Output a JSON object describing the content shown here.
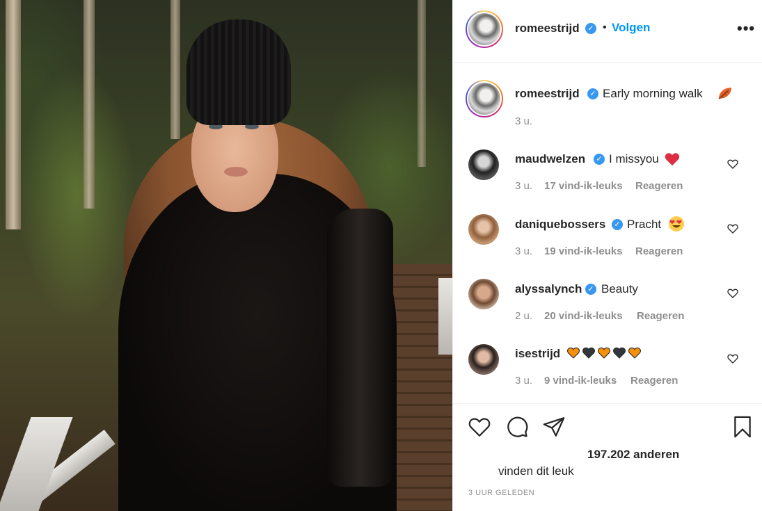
{
  "post": {
    "author": "romeestrijd",
    "follow_label": "Volgen",
    "follow_separator": "•",
    "more_label": "•••",
    "caption_author": "romeestrijd",
    "caption_text": "Early morning walk",
    "caption_emoji": "🍂",
    "caption_time": "3 u."
  },
  "comments": [
    {
      "user": "maudwelzen",
      "verified": true,
      "text": "I missyou",
      "emoji": "❤️",
      "time": "3 u.",
      "likes": "17 vind-ik-leuks",
      "reply": "Reageren"
    },
    {
      "user": "daniquebossers",
      "verified": true,
      "text": "Pracht",
      "emoji": "😍",
      "time": "3 u.",
      "likes": "19 vind-ik-leuks",
      "reply": "Reageren"
    },
    {
      "user": "alyssalynch",
      "verified": true,
      "text": "Beauty",
      "emoji": "",
      "time": "2 u.",
      "likes": "20 vind-ik-leuks",
      "reply": "Reageren"
    },
    {
      "user": "isestrijd",
      "verified": false,
      "text": "",
      "emoji": "🧡🖤🧡🖤🧡",
      "time": "3 u.",
      "likes": "9 vind-ik-leuks",
      "reply": "Reageren"
    }
  ],
  "actions": {
    "icons": [
      "heart-icon",
      "comment-icon",
      "share-icon",
      "bookmark-icon"
    ],
    "likes_count": "197.202 anderen",
    "likes_suffix": "vinden dit leuk",
    "timestamp": "3 UUR GELEDEN"
  },
  "colors": {
    "accent": "#0095f6",
    "verified": "#3897f0",
    "muted": "#8e8e8e",
    "text": "#262626",
    "orange_heart": "#f4900c",
    "black_heart": "#31373d",
    "red_heart": "#dd2e44"
  }
}
